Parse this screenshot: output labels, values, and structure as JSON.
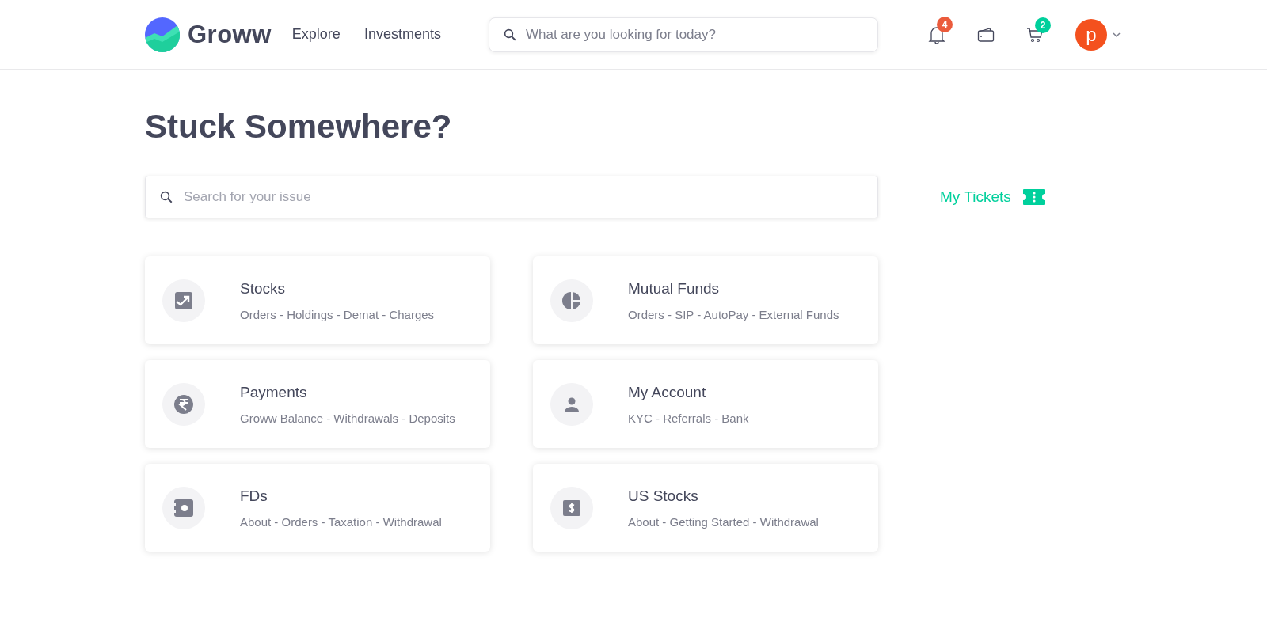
{
  "header": {
    "logo_text": "Groww",
    "nav": [
      "Explore",
      "Investments"
    ],
    "search": {
      "placeholder": "What are you looking for today?"
    },
    "icons": [
      {
        "kind": "bell",
        "badge": "4",
        "color": "#eb5b3c"
      },
      {
        "kind": "wallet"
      },
      {
        "kind": "cart",
        "badge": "2",
        "color": "#00d09c"
      }
    ],
    "avatar": "p"
  },
  "title": "Stuck Somewhere?",
  "issue_search": {
    "placeholder": "Search for your issue"
  },
  "my_tickets": "My Tickets",
  "categories": [
    {
      "kind": "stocks",
      "title": "Stocks",
      "subtitle": "Orders - Holdings - Demat - Charges"
    },
    {
      "kind": "funds",
      "title": "Mutual Funds",
      "subtitle": "Orders - SIP - AutoPay - External Funds"
    },
    {
      "kind": "payments",
      "title": "Payments",
      "subtitle": "Groww Balance - Withdrawals - Deposits"
    },
    {
      "kind": "account",
      "title": "My Account",
      "subtitle": "KYC - Referrals - Bank"
    },
    {
      "kind": "fd",
      "title": "FDs",
      "subtitle": "About - Orders - Taxation - Withdrawal"
    },
    {
      "kind": "us",
      "title": "US Stocks",
      "subtitle": "About - Getting Started - Withdrawal"
    }
  ]
}
